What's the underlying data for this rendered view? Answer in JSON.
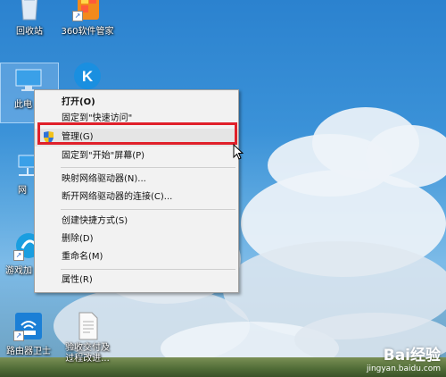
{
  "desktop": {
    "icons": [
      {
        "label": "回收站"
      },
      {
        "label": "360软件管家"
      },
      {
        "label": "此电"
      },
      {
        "label": ""
      },
      {
        "label": "网"
      },
      {
        "label": "游戏加"
      },
      {
        "label": "路由器卫士"
      },
      {
        "label": "验收交付及\n过程改进..."
      }
    ]
  },
  "context_menu": {
    "items": [
      {
        "label": "打开(O)"
      },
      {
        "label": "固定到\"快速访问\""
      },
      {
        "label": "管理(G)"
      },
      {
        "label": "固定到\"开始\"屏幕(P)"
      },
      {
        "label": "映射网络驱动器(N)..."
      },
      {
        "label": "断开网络驱动器的连接(C)..."
      },
      {
        "label": "创建快捷方式(S)"
      },
      {
        "label": "删除(D)"
      },
      {
        "label": "重命名(M)"
      },
      {
        "label": "属性(R)"
      }
    ]
  },
  "watermark": {
    "brand": "Bai经验",
    "url": "jingyan.baidu.com"
  },
  "colors": {
    "highlight_border": "#e0202a",
    "menu_bg": "#f2f2f2"
  }
}
